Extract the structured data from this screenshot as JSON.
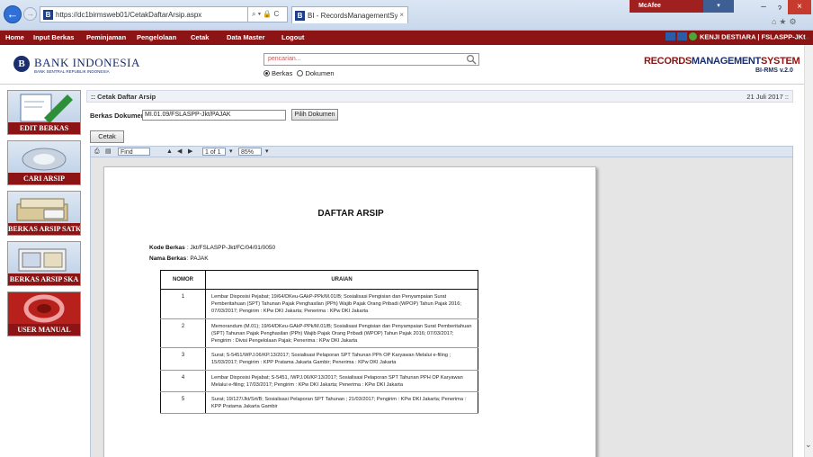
{
  "browser": {
    "url": "https://dc1birmsweb01/CetakDaftarArsip.aspx",
    "address_tools": "⌕ ▾ 🔒 C",
    "tab_title": "BI - RecordsManagementSy...",
    "tab_close": "×",
    "mcafee_label": "McAfee",
    "mcafee_drop": "▾",
    "minimize": "–",
    "maximize": "ɂ",
    "close": "×",
    "toolbar_icons": "⌂★⚙"
  },
  "menu": {
    "items": [
      "Home",
      "Input Berkas",
      "Peminjaman",
      "Pengelolaan",
      "Cetak",
      "Data Master",
      "Logout"
    ],
    "user": "KENJI DESTIARA | FSLASPP-JKt"
  },
  "header": {
    "logo_text": "BANK INDONESIA",
    "logo_sub": "BANK SENTRAL REPUBLIK INDONESIA",
    "logo_mark": "B",
    "search_placeholder": "pencarian...",
    "radio_berkas": "Berkas",
    "radio_dokumen": "Dokumen",
    "rms_left": "RECORDS",
    "rms_mid": "MANAGEMENT",
    "rms_right": "SYSTEM",
    "rms_version": "BI-RMS v.2.0"
  },
  "sidebar": {
    "items": [
      "EDIT BERKAS",
      "CARI ARSIP",
      "BERKAS ARSIP SATKER",
      "BERKAS ARSIP SKA",
      "USER MANUAL"
    ]
  },
  "content": {
    "title": ":: Cetak Daftar Arsip",
    "date": "21 Juli 2017 ::",
    "berkas_label": "Berkas Dokumen",
    "berkas_value": "MI.01.09/FSLASPP-Jkt/PAJAK",
    "pilih_label": "Pilih Dokumen",
    "cetak_label": "Cetak"
  },
  "viewer": {
    "find_label": "Find",
    "next_label": "Next",
    "page_label": "1 of 1",
    "zoom": "85%"
  },
  "report": {
    "title": "DAFTAR ARSIP",
    "kode_label": "Kode Berkas",
    "kode_value": ": Jkt/FSLASPP-Jkt/FC/04/01/0050",
    "nama_label": "Nama Berkas",
    "nama_value": ": PAJAK",
    "col_nomor": "NOMOR",
    "col_uraian": "URAIAN",
    "rows": [
      {
        "no": "1",
        "text": "Lembar Disposisi Pejabat; 19/64/DKeu-GAkP-PPk/M.01/B; Sosialisasi Pengisian dan Penyampaian Surat Pemberitahuan (SPT) Tahunan Pajak Penghasilan (PPh) Wajib Pajak Orang Pribadi (WPOP) Tahun Pajak 2016; 07/03/2017; Pengirim : KPw DKI Jakarta; Penerima : KPw DKI Jakarta"
      },
      {
        "no": "2",
        "text": "Memorandum (M.01); 19/64/DKeu-GAkP-PPk/M.01/B; Sosialisasi Pengisian dan Penyampaian Surat Pemberitahuan (SPT) Tahunan Pajak Penghasilan (PPh) Wajib Pajak Orang Pribadi (WPOP) Tahun Pajak 2016; 07/03/2017; Pengirim : Divisi Pengelolaan Pajak; Penerima : KPw DKI Jakarta"
      },
      {
        "no": "3",
        "text": "Surat; S-5451/WPJ.06/KP.13/2017; Sosialisasi Pelaporan SPT Tahunan PPh OP Karyawan Melalui e-filing ; 15/03/2017; Pengirim : KPP Pratama Jakarta Gambir; Penerima : KPw DKI Jakarta"
      },
      {
        "no": "4",
        "text": "Lembar Disposisi Pejabat; S-5451, /WPJ.06/KP.13/2017; Sosialisasi Pelaporan SPT Tahunan PPH OP Karyawan Melalui e-filing; 17/03/2017; Pengirim : KPw DKI Jakarta; Penerima : KPw DKI Jakarta"
      },
      {
        "no": "5",
        "text": "Surat; 19/127/Jkt/Srt/B; Sosialisasi Pelaporan SPT Tahunan ; 21/03/2017; Pengirim : KPw DKI Jakarta; Penerima : KPP Pratama Jakarta Gambir"
      }
    ]
  }
}
